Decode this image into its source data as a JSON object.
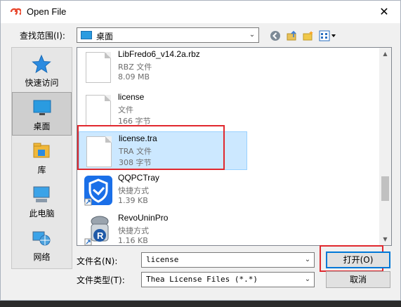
{
  "window": {
    "title": "Open File",
    "close_glyph": "✕"
  },
  "lookin": {
    "label": "查找范围(I):",
    "value": "桌面"
  },
  "toolbar": {
    "icons": [
      "back-icon",
      "up-folder-icon",
      "new-folder-icon",
      "view-menu-icon"
    ]
  },
  "places": [
    {
      "label": "快速访问",
      "icon": "star-icon"
    },
    {
      "label": "桌面",
      "icon": "desktop-icon",
      "selected": true
    },
    {
      "label": "库",
      "icon": "library-icon"
    },
    {
      "label": "此电脑",
      "icon": "computer-icon"
    },
    {
      "label": "网络",
      "icon": "network-icon"
    }
  ],
  "files": [
    {
      "name": "LibFredo6_v14.2a.rbz",
      "type": "RBZ 文件",
      "size": "8.09 MB",
      "icon": "document-icon"
    },
    {
      "name": "license",
      "type": "文件",
      "size": "166 字节",
      "icon": "document-icon"
    },
    {
      "name": "license.tra",
      "type": "TRA 文件",
      "size": "308 字节",
      "icon": "document-icon",
      "selected": true
    },
    {
      "name": "QQPCTray",
      "type": "快捷方式",
      "size": "1.39 KB",
      "icon": "qqpc-shield-icon"
    },
    {
      "name": "RevoUninPro",
      "type": "快捷方式",
      "size": "1.16 KB",
      "icon": "revo-uninstaller-icon"
    }
  ],
  "filename": {
    "label": "文件名(N):",
    "value": "license"
  },
  "filetype": {
    "label": "文件类型(T):",
    "value": "Thea License Files (*.*)"
  },
  "buttons": {
    "open": "打开(O)",
    "cancel": "取消"
  },
  "colors": {
    "highlight_box": "#e0282e",
    "selection": "#cce8ff",
    "accent": "#0078d7"
  }
}
